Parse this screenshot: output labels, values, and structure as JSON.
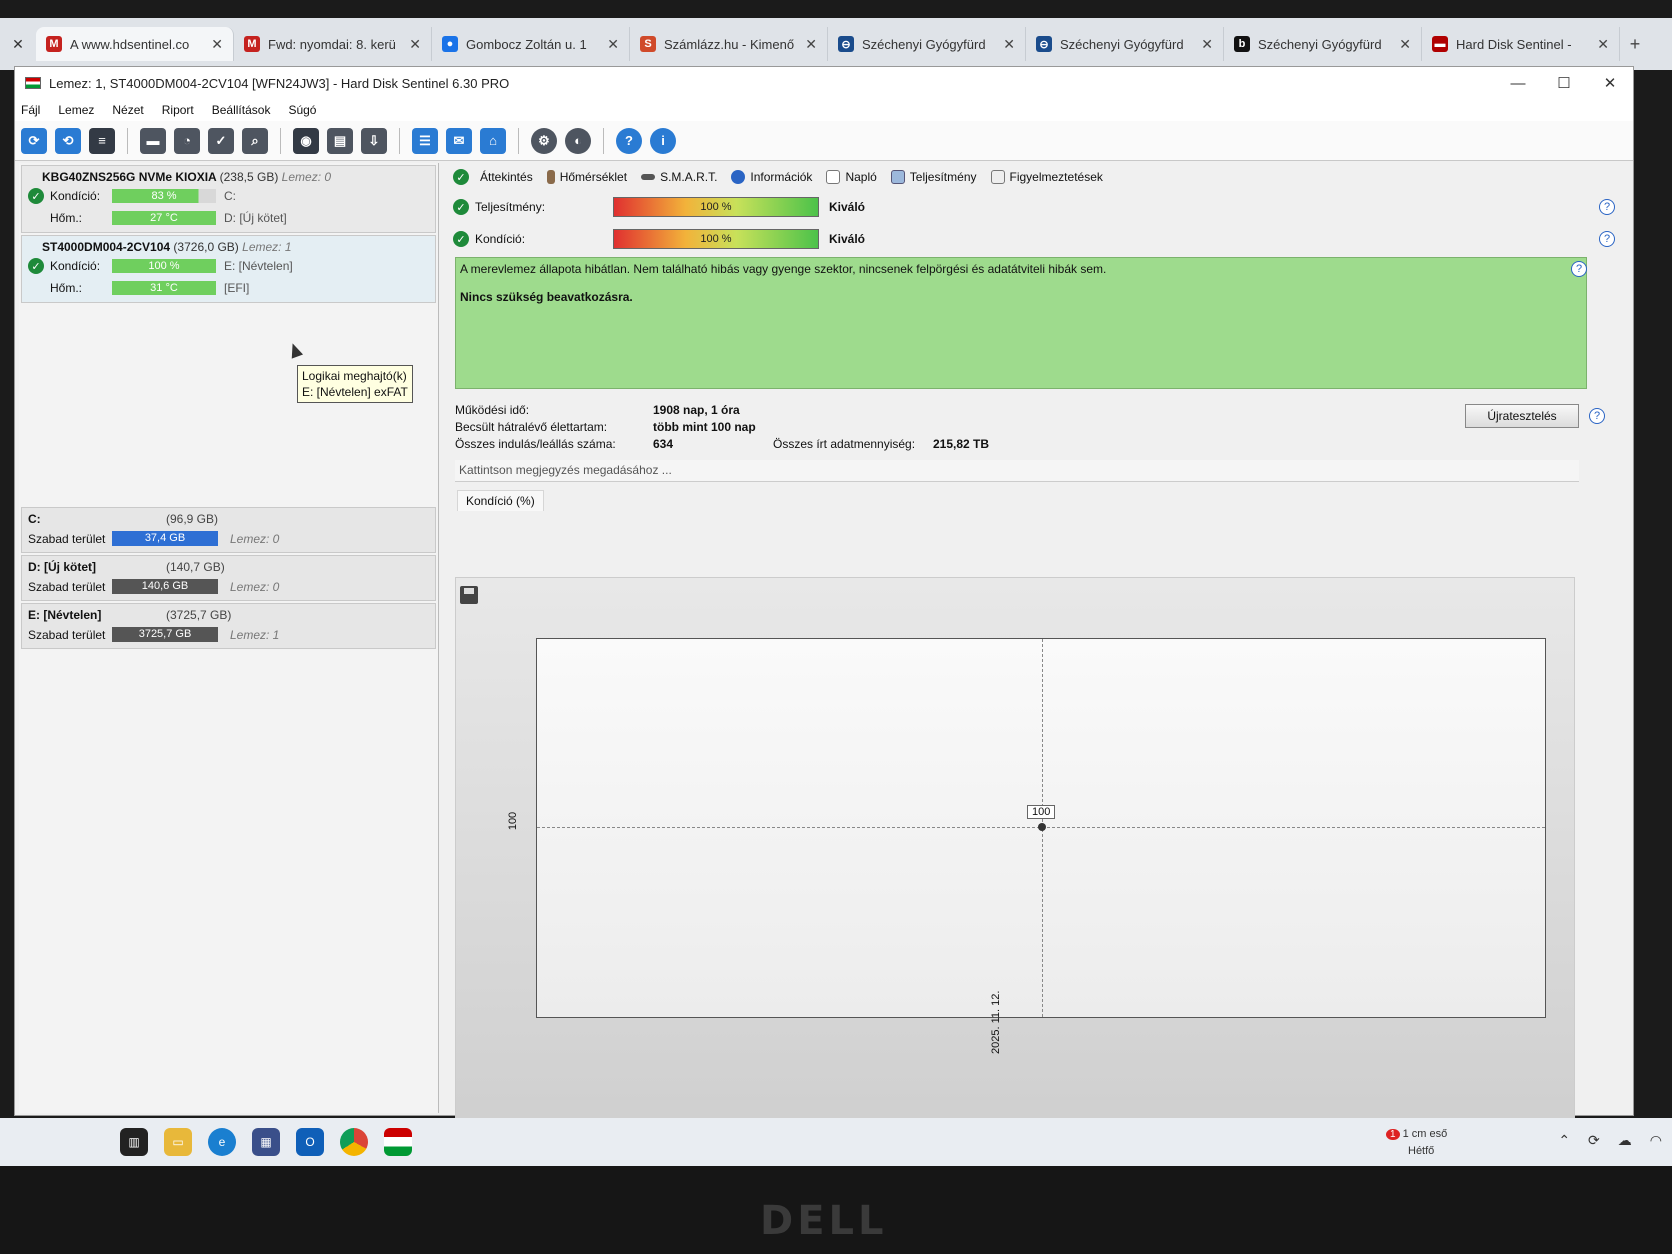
{
  "browser": {
    "tabs": [
      {
        "title": "A www.hdsentinel.co",
        "fav": "M",
        "color": "#c5221f",
        "active": true
      },
      {
        "title": "Fwd: nyomdai: 8. kerü",
        "fav": "M",
        "color": "#c5221f"
      },
      {
        "title": "Gombocz Zoltán u. 1",
        "fav": "●",
        "color": "#1a73e8"
      },
      {
        "title": "Számlázz.hu - Kimenő",
        "fav": "S",
        "color": "#d04a2a"
      },
      {
        "title": "Széchenyi Gyógyfürd",
        "fav": "⊖",
        "color": "#1a4c8c"
      },
      {
        "title": "Széchenyi Gyógyfürd",
        "fav": "⊖",
        "color": "#1a4c8c"
      },
      {
        "title": "Széchenyi Gyógyfürd",
        "fav": "b",
        "color": "#111111"
      },
      {
        "title": "Hard Disk Sentinel -",
        "fav": "▬",
        "color": "#b00000"
      }
    ]
  },
  "window": {
    "title": "Lemez: 1, ST4000DM004-2CV104 [WFN24JW3]  -  Hard Disk Sentinel 6.30 PRO"
  },
  "menu": [
    "Fájl",
    "Lemez",
    "Nézet",
    "Riport",
    "Beállítások",
    "Súgó"
  ],
  "disks": [
    {
      "name": "KBG40ZNS256G NVMe KIOXIA",
      "size": "(238,5 GB)",
      "lemez": "Lemez: 0",
      "kondicio_label": "Kondíció:",
      "kondicio": "83 %",
      "kondicio_pct": 83,
      "vol1": "C:",
      "hom_label": "Hőm.:",
      "hom": "27 °C",
      "vol2": "D: [Új kötet]"
    },
    {
      "name": "ST4000DM004-2CV104",
      "size": "(3726,0 GB)",
      "lemez": "Lemez: 1",
      "kondicio_label": "Kondíció:",
      "kondicio": "100 %",
      "kondicio_pct": 100,
      "vol1": "E: [Névtelen]",
      "hom_label": "Hőm.:",
      "hom": "31 °C",
      "vol2": "[EFI]"
    }
  ],
  "tooltip": {
    "line1": "Logikai meghajtó(k)",
    "line2": "E: [Névtelen] exFAT"
  },
  "volumes": [
    {
      "name": "C:",
      "size": "(96,9 GB)",
      "free_label": "Szabad terület",
      "free": "37,4 GB",
      "lemez": "Lemez: 0",
      "color": "#2e6fd4"
    },
    {
      "name": "D: [Új kötet]",
      "size": "(140,7 GB)",
      "free_label": "Szabad terület",
      "free": "140,6 GB",
      "lemez": "Lemez: 0",
      "color": "#555555"
    },
    {
      "name": "E: [Névtelen]",
      "size": "(3725,7 GB)",
      "free_label": "Szabad terület",
      "free": "3725,7 GB",
      "lemez": "Lemez: 1",
      "color": "#555555"
    }
  ],
  "tabs": [
    "Áttekintés",
    "Hőmérséklet",
    "S.M.A.R.T.",
    "Információk",
    "Napló",
    "Teljesítmény",
    "Figyelmeztetések"
  ],
  "metrics": [
    {
      "label": "Teljesítmény:",
      "value": "100 %",
      "rating": "Kiváló"
    },
    {
      "label": "Kondíció:",
      "value": "100 %",
      "rating": "Kiváló"
    }
  ],
  "status": {
    "line1": "A merevlemez állapota hibátlan. Nem található hibás vagy gyenge szektor, nincsenek felpörgési és adatátviteli hibák sem.",
    "line2": "Nincs szükség beavatkozásra."
  },
  "stats": {
    "mukodesi_label": "Működési idő:",
    "mukodesi": "1908 nap, 1 óra",
    "elettartam_label": "Becsült hátralévő élettartam:",
    "elettartam": "több mint 100 nap",
    "indulas_label": "Összes indulás/leállás száma:",
    "indulas": "634",
    "irt_label": "Összes írt adatmennyiség:",
    "irt": "215,82 TB",
    "retest": "Újratesztelés"
  },
  "note_placeholder": "Kattintson megjegyzés megadásához ...",
  "chart_tab": "Kondíció  (%)",
  "chart_data": {
    "type": "line",
    "x": [
      "2025. 11. 12."
    ],
    "series": [
      {
        "values": [
          100
        ]
      }
    ],
    "ylabel_tick": "100",
    "point_label": "100"
  },
  "taskbar": {
    "weather_line1": "1 cm eső",
    "weather_line2": "Hétfő",
    "badge": "1"
  },
  "brand": "DELL"
}
